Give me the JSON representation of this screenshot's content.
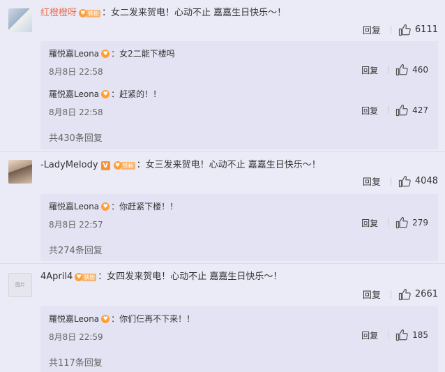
{
  "labels": {
    "reply": "回复",
    "fan_badge": "铁粉",
    "v_badge": "V",
    "avatar_placeholder": "图片"
  },
  "comments": [
    {
      "user": "红橙橙呀",
      "text": "：女二发来贺电！心动不止 嘉嘉生日快乐～！",
      "likes": "6111",
      "replies": [
        {
          "user": "羅悦嘉Leona",
          "text": "：女2二能下楼吗",
          "time": "8月8日 22:58",
          "likes": "460"
        },
        {
          "user": "羅悦嘉Leona",
          "text": "：赶紧的！！",
          "time": "8月8日 22:58",
          "likes": "427"
        }
      ],
      "more": "共430条回复"
    },
    {
      "user": "-LadyMelody",
      "text": "：女三发来贺电！心动不止 嘉嘉生日快乐～！",
      "likes": "4048",
      "replies": [
        {
          "user": "羅悦嘉Leona",
          "text": "：你赶紧下楼！！",
          "time": "8月8日 22:57",
          "likes": "279"
        }
      ],
      "more": "共274条回复"
    },
    {
      "user": "4April4",
      "text": "：女四发来贺电！心动不止 嘉嘉生日快乐～！",
      "likes": "2661",
      "replies": [
        {
          "user": "羅悦嘉Leona",
          "text": "：你们仨再不下来！！",
          "time": "8月8日 22:59",
          "likes": "185"
        }
      ],
      "more": "共117条回复"
    }
  ]
}
